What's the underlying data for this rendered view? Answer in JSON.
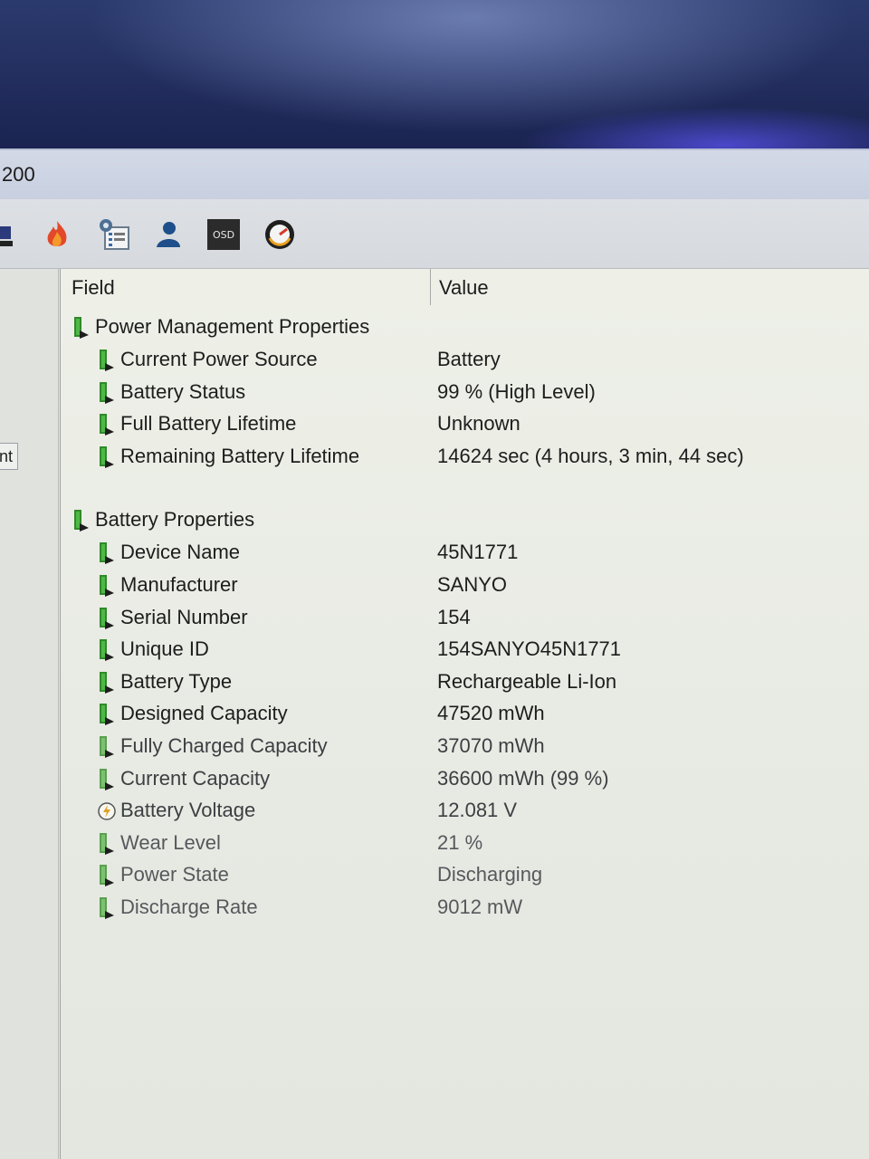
{
  "window": {
    "title_fragment": "200"
  },
  "toolbar": {
    "icons": [
      "computer-icon",
      "flame-icon",
      "calendar-task-icon",
      "user-icon",
      "osd-icon",
      "gauge-icon"
    ],
    "osd_label": "OSD"
  },
  "left_pane": {
    "tab_fragment": "nt"
  },
  "list": {
    "columns": {
      "field": "Field",
      "value": "Value"
    },
    "groups": [
      {
        "title": "Power Management Properties",
        "rows": [
          {
            "field": "Current Power Source",
            "value": "Battery"
          },
          {
            "field": "Battery Status",
            "value": "99 % (High Level)"
          },
          {
            "field": "Full Battery Lifetime",
            "value": "Unknown"
          },
          {
            "field": "Remaining Battery Lifetime",
            "value": "14624 sec (4 hours, 3 min, 44 sec)"
          }
        ]
      },
      {
        "title": "Battery Properties",
        "rows": [
          {
            "field": "Device Name",
            "value": "45N1771"
          },
          {
            "field": "Manufacturer",
            "value": "SANYO"
          },
          {
            "field": "Serial Number",
            "value": "154"
          },
          {
            "field": "Unique ID",
            "value": "154SANYO45N1771"
          },
          {
            "field": "Battery Type",
            "value": "Rechargeable Li-Ion"
          },
          {
            "field": "Designed Capacity",
            "value": "47520 mWh"
          },
          {
            "field": "Fully Charged Capacity",
            "value": "37070 mWh"
          },
          {
            "field": "Current Capacity",
            "value": "36600 mWh  (99 %)"
          },
          {
            "field": "Battery Voltage",
            "value": "12.081 V"
          },
          {
            "field": "Wear Level",
            "value": "21 %"
          },
          {
            "field": "Power State",
            "value": "Discharging"
          },
          {
            "field": "Discharge Rate",
            "value": "9012 mW"
          }
        ]
      }
    ]
  }
}
